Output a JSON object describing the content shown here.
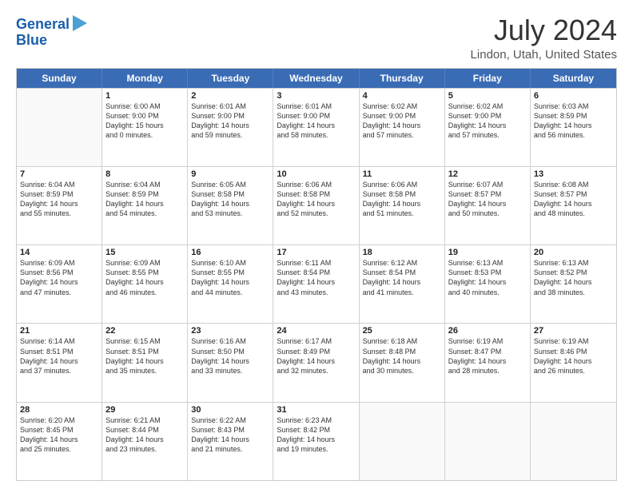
{
  "header": {
    "logo_line1": "General",
    "logo_line2": "Blue",
    "main_title": "July 2024",
    "subtitle": "Lindon, Utah, United States"
  },
  "calendar": {
    "days": [
      "Sunday",
      "Monday",
      "Tuesday",
      "Wednesday",
      "Thursday",
      "Friday",
      "Saturday"
    ],
    "rows": [
      [
        {
          "day": "",
          "info": ""
        },
        {
          "day": "1",
          "info": "Sunrise: 6:00 AM\nSunset: 9:00 PM\nDaylight: 15 hours\nand 0 minutes."
        },
        {
          "day": "2",
          "info": "Sunrise: 6:01 AM\nSunset: 9:00 PM\nDaylight: 14 hours\nand 59 minutes."
        },
        {
          "day": "3",
          "info": "Sunrise: 6:01 AM\nSunset: 9:00 PM\nDaylight: 14 hours\nand 58 minutes."
        },
        {
          "day": "4",
          "info": "Sunrise: 6:02 AM\nSunset: 9:00 PM\nDaylight: 14 hours\nand 57 minutes."
        },
        {
          "day": "5",
          "info": "Sunrise: 6:02 AM\nSunset: 9:00 PM\nDaylight: 14 hours\nand 57 minutes."
        },
        {
          "day": "6",
          "info": "Sunrise: 6:03 AM\nSunset: 8:59 PM\nDaylight: 14 hours\nand 56 minutes."
        }
      ],
      [
        {
          "day": "7",
          "info": "Sunrise: 6:04 AM\nSunset: 8:59 PM\nDaylight: 14 hours\nand 55 minutes."
        },
        {
          "day": "8",
          "info": "Sunrise: 6:04 AM\nSunset: 8:59 PM\nDaylight: 14 hours\nand 54 minutes."
        },
        {
          "day": "9",
          "info": "Sunrise: 6:05 AM\nSunset: 8:58 PM\nDaylight: 14 hours\nand 53 minutes."
        },
        {
          "day": "10",
          "info": "Sunrise: 6:06 AM\nSunset: 8:58 PM\nDaylight: 14 hours\nand 52 minutes."
        },
        {
          "day": "11",
          "info": "Sunrise: 6:06 AM\nSunset: 8:58 PM\nDaylight: 14 hours\nand 51 minutes."
        },
        {
          "day": "12",
          "info": "Sunrise: 6:07 AM\nSunset: 8:57 PM\nDaylight: 14 hours\nand 50 minutes."
        },
        {
          "day": "13",
          "info": "Sunrise: 6:08 AM\nSunset: 8:57 PM\nDaylight: 14 hours\nand 48 minutes."
        }
      ],
      [
        {
          "day": "14",
          "info": "Sunrise: 6:09 AM\nSunset: 8:56 PM\nDaylight: 14 hours\nand 47 minutes."
        },
        {
          "day": "15",
          "info": "Sunrise: 6:09 AM\nSunset: 8:55 PM\nDaylight: 14 hours\nand 46 minutes."
        },
        {
          "day": "16",
          "info": "Sunrise: 6:10 AM\nSunset: 8:55 PM\nDaylight: 14 hours\nand 44 minutes."
        },
        {
          "day": "17",
          "info": "Sunrise: 6:11 AM\nSunset: 8:54 PM\nDaylight: 14 hours\nand 43 minutes."
        },
        {
          "day": "18",
          "info": "Sunrise: 6:12 AM\nSunset: 8:54 PM\nDaylight: 14 hours\nand 41 minutes."
        },
        {
          "day": "19",
          "info": "Sunrise: 6:13 AM\nSunset: 8:53 PM\nDaylight: 14 hours\nand 40 minutes."
        },
        {
          "day": "20",
          "info": "Sunrise: 6:13 AM\nSunset: 8:52 PM\nDaylight: 14 hours\nand 38 minutes."
        }
      ],
      [
        {
          "day": "21",
          "info": "Sunrise: 6:14 AM\nSunset: 8:51 PM\nDaylight: 14 hours\nand 37 minutes."
        },
        {
          "day": "22",
          "info": "Sunrise: 6:15 AM\nSunset: 8:51 PM\nDaylight: 14 hours\nand 35 minutes."
        },
        {
          "day": "23",
          "info": "Sunrise: 6:16 AM\nSunset: 8:50 PM\nDaylight: 14 hours\nand 33 minutes."
        },
        {
          "day": "24",
          "info": "Sunrise: 6:17 AM\nSunset: 8:49 PM\nDaylight: 14 hours\nand 32 minutes."
        },
        {
          "day": "25",
          "info": "Sunrise: 6:18 AM\nSunset: 8:48 PM\nDaylight: 14 hours\nand 30 minutes."
        },
        {
          "day": "26",
          "info": "Sunrise: 6:19 AM\nSunset: 8:47 PM\nDaylight: 14 hours\nand 28 minutes."
        },
        {
          "day": "27",
          "info": "Sunrise: 6:19 AM\nSunset: 8:46 PM\nDaylight: 14 hours\nand 26 minutes."
        }
      ],
      [
        {
          "day": "28",
          "info": "Sunrise: 6:20 AM\nSunset: 8:45 PM\nDaylight: 14 hours\nand 25 minutes."
        },
        {
          "day": "29",
          "info": "Sunrise: 6:21 AM\nSunset: 8:44 PM\nDaylight: 14 hours\nand 23 minutes."
        },
        {
          "day": "30",
          "info": "Sunrise: 6:22 AM\nSunset: 8:43 PM\nDaylight: 14 hours\nand 21 minutes."
        },
        {
          "day": "31",
          "info": "Sunrise: 6:23 AM\nSunset: 8:42 PM\nDaylight: 14 hours\nand 19 minutes."
        },
        {
          "day": "",
          "info": ""
        },
        {
          "day": "",
          "info": ""
        },
        {
          "day": "",
          "info": ""
        }
      ]
    ]
  }
}
